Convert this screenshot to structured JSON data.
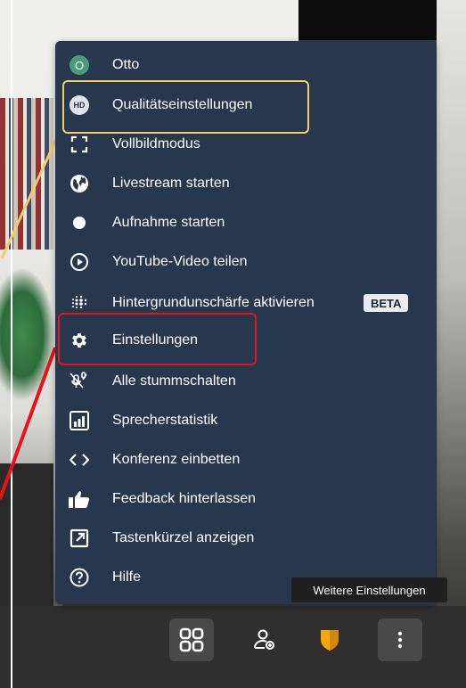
{
  "menu": {
    "items": [
      {
        "label": "Otto",
        "icon": "avatar-icon",
        "avatar_initial": "O"
      },
      {
        "label": "Qualitätseinstellungen",
        "icon": "hd-icon",
        "icon_text": "HD"
      },
      {
        "label": "Vollbildmodus",
        "icon": "fullscreen-icon"
      },
      {
        "label": "Livestream starten",
        "icon": "globe-icon"
      },
      {
        "label": "Aufnahme starten",
        "icon": "record-icon"
      },
      {
        "label": "YouTube-Video teilen",
        "icon": "play-circle-icon"
      },
      {
        "label": "Hintergrundunschärfe aktivieren",
        "icon": "blur-icon",
        "badge": "BETA"
      },
      {
        "label": "Einstellungen",
        "icon": "gear-icon"
      },
      {
        "label": "Alle stummschalten",
        "icon": "mute-all-icon"
      },
      {
        "label": "Sprecherstatistik",
        "icon": "bar-chart-icon"
      },
      {
        "label": "Konferenz einbetten",
        "icon": "code-icon"
      },
      {
        "label": "Feedback hinterlassen",
        "icon": "thumbs-up-icon"
      },
      {
        "label": "Tastenkürzel anzeigen",
        "icon": "external-link-icon"
      },
      {
        "label": "Hilfe",
        "icon": "help-icon"
      }
    ]
  },
  "tooltip": "Weitere Einstellungen",
  "colors": {
    "menu_bg": "#27374d",
    "highlight_yellow": "#f2cd6d",
    "highlight_red": "#e8121a",
    "avatar_green": "#4c9a7c",
    "toolbar_button_bg": "#494949",
    "shield_orange": "#f4a70b"
  }
}
